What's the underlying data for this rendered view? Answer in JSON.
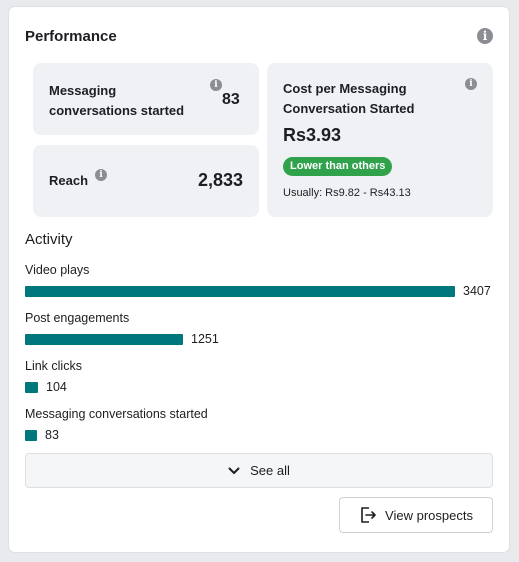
{
  "performance": {
    "title": "Performance",
    "tiles": {
      "messaging": {
        "label": "Messaging conversations started",
        "value": "83"
      },
      "reach": {
        "label": "Reach",
        "value": "2,833"
      },
      "cost": {
        "label": "Cost per Messaging Conversation Started",
        "value": "Rs3.93",
        "badge": "Lower than others",
        "usually": "Usually: Rs9.82 - Rs43.13",
        "badge_color": "#31a24c"
      }
    }
  },
  "activity": {
    "title": "Activity",
    "bar_color": "#00777a",
    "max_value": 3407,
    "metrics": [
      {
        "label": "Video plays",
        "value": 3407,
        "display": "3407"
      },
      {
        "label": "Post engagements",
        "value": 1251,
        "display": "1251"
      },
      {
        "label": "Link clicks",
        "value": 104,
        "display": "104"
      },
      {
        "label": "Messaging conversations started",
        "value": 83,
        "display": "83"
      }
    ]
  },
  "buttons": {
    "see_all": "See all",
    "view_prospects": "View prospects"
  },
  "icons": {
    "info": "info-icon",
    "chevron": "chevron-down-icon",
    "exit": "exit-door-icon"
  }
}
